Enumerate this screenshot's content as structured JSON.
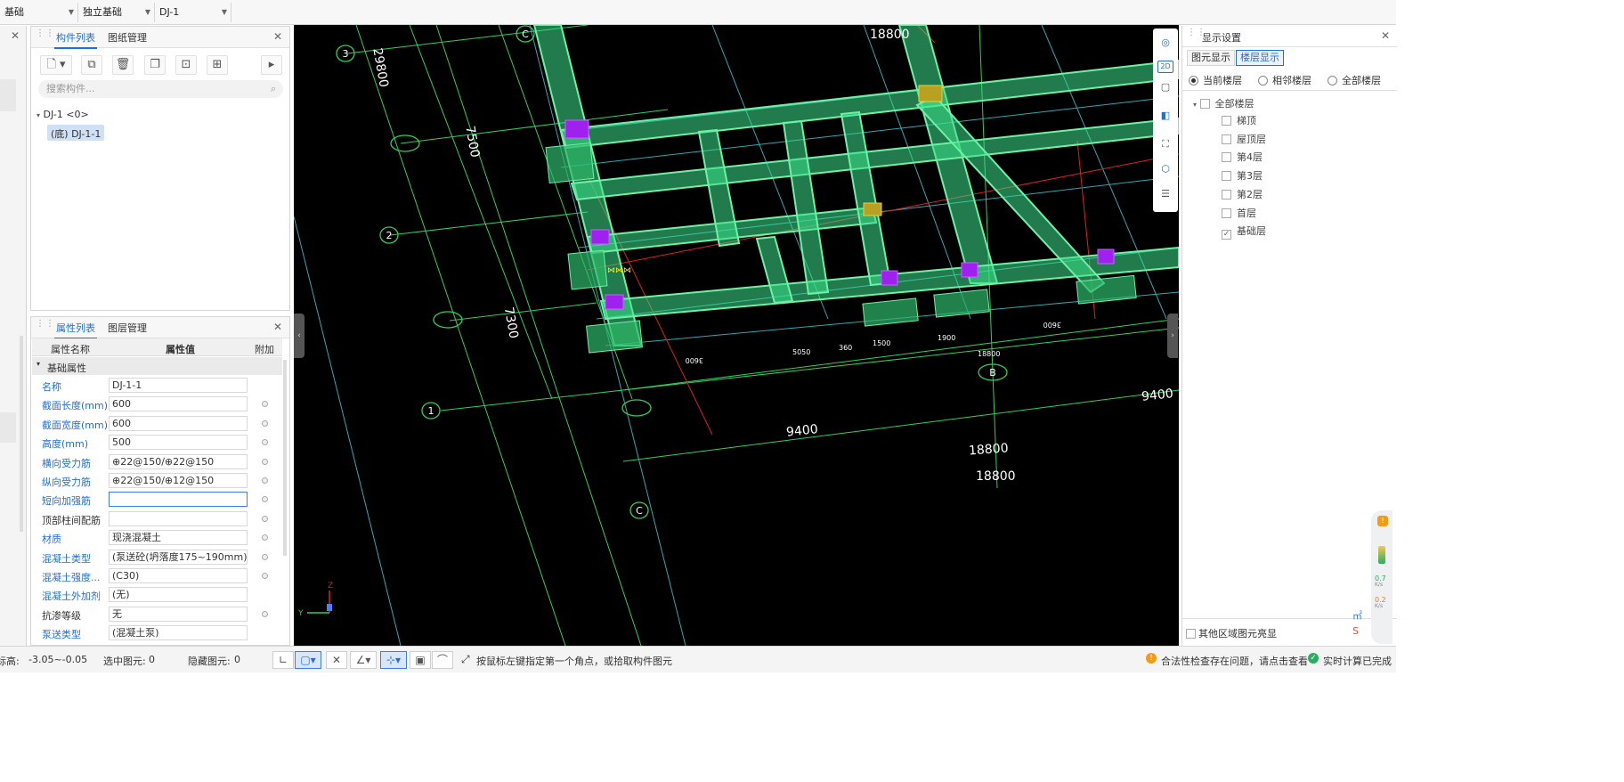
{
  "topbar": {
    "dropdowns": [
      "基础",
      "独立基础",
      "DJ-1"
    ]
  },
  "component_panel": {
    "tabs": [
      "构件列表",
      "图纸管理"
    ],
    "search_placeholder": "搜索构件...",
    "tree_root": "DJ-1 <0>",
    "tree_child": "(底) DJ-1-1"
  },
  "property_panel": {
    "tabs": [
      "属性列表",
      "图层管理"
    ],
    "headers": [
      "属性名称",
      "属性值",
      "附加"
    ],
    "group": "基础属性",
    "rows": [
      {
        "name": "名称",
        "value": "DJ-1-1"
      },
      {
        "name": "截面长度(mm)",
        "value": "600"
      },
      {
        "name": "截面宽度(mm)",
        "value": "600"
      },
      {
        "name": "高度(mm)",
        "value": "500"
      },
      {
        "name": "横向受力筋",
        "value": "⊕22@150/⊕22@150"
      },
      {
        "name": "纵向受力筋",
        "value": "⊕22@150/⊕12@150"
      },
      {
        "name": "短向加强筋",
        "value": ""
      },
      {
        "name": "顶部柱间配筋",
        "value": ""
      },
      {
        "name": "材质",
        "value": "现浇混凝土"
      },
      {
        "name": "混凝土类型",
        "value": "(泵送砼(坍落度175~190mm) ..."
      },
      {
        "name": "混凝土强度...",
        "value": "(C30)"
      },
      {
        "name": "混凝土外加剂",
        "value": "(无)"
      },
      {
        "name": "抗渗等级",
        "value": "无"
      },
      {
        "name": "泵送类型",
        "value": "(混凝土泵)"
      }
    ]
  },
  "display_panel": {
    "title": "显示设置",
    "tabs": [
      "图元显示",
      "楼层显示"
    ],
    "radios": [
      "当前楼层",
      "相邻楼层",
      "全部楼层"
    ],
    "floors_root": "全部楼层",
    "floors": [
      "梯顶",
      "屋顶层",
      "第4层",
      "第3层",
      "第2层",
      "首层",
      "基础层"
    ],
    "checked_floor": "基础层",
    "footer_check": "其他区域图元亮显"
  },
  "canvas": {
    "dims": {
      "d29800": "29800",
      "d18800a": "18800",
      "d7500": "7500",
      "d7300": "7300",
      "d9400a": "9400",
      "d9400b": "9400",
      "d18800b": "18800",
      "d18800c": "18800"
    },
    "axis_labels": [
      "3",
      "2",
      "1",
      "C",
      "C",
      "B"
    ],
    "small_dims": [
      "3600",
      "5050",
      "360",
      "1500",
      "1900",
      "18800",
      "3600"
    ]
  },
  "status": {
    "elevation": "标高:",
    "elevation_val": "-3.05~-0.05",
    "selected": "选中图元:",
    "selected_val": "0",
    "hidden": "隐藏图元:",
    "hidden_val": "0",
    "hint": "按鼠标左键指定第一个角点，或拾取构件图元",
    "check_msg": "合法性检查存在问题，请点击查看",
    "calc_msg": "实时计算已完成"
  },
  "speed": {
    "up": "0.7",
    "down": "0.2",
    "unit": "K/s"
  },
  "colors": {
    "accent": "#1f6fd8",
    "beam": "#3de08a",
    "column": "#a020f0",
    "grid": "#36c7d1"
  }
}
